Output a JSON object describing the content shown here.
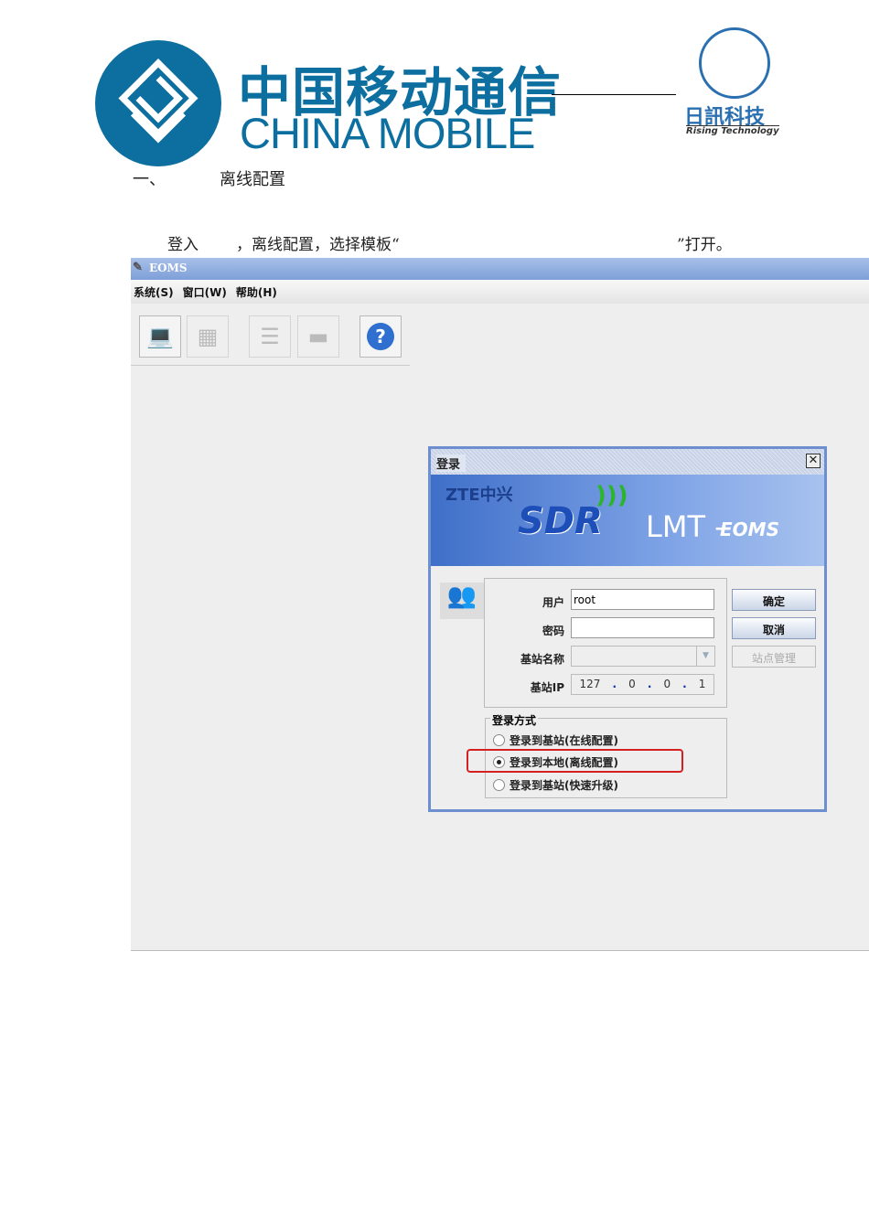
{
  "header": {
    "china_mobile_cn": "中国移动通信",
    "china_mobile_en": "CHINA MOBILE",
    "rising_cn": "日訊科技",
    "rising_en": "Rising Technology"
  },
  "doc": {
    "section_number": "一、",
    "section_title": "离线配置",
    "instruction_part1": "登入",
    "instruction_part2": "，离线配置，选择模板“",
    "instruction_part3": "”打开。"
  },
  "app": {
    "title": "EOMS",
    "menu": [
      {
        "label": "系统(S)"
      },
      {
        "label": "窗口(W)"
      },
      {
        "label": "帮助(H)"
      }
    ],
    "toolbar": [
      {
        "icon": "connect-icon",
        "enabled": true
      },
      {
        "icon": "offline-config-icon",
        "enabled": false
      },
      {
        "icon": "tree-icon",
        "enabled": false
      },
      {
        "icon": "panel-icon",
        "enabled": false
      },
      {
        "icon": "help-icon",
        "enabled": true
      }
    ],
    "login_dialog": {
      "title": "登录",
      "banner": {
        "brand": "ZTE中兴",
        "product": "SDR",
        "lmt": "LMT -",
        "eoms": "EOMS"
      },
      "user_label": "用户",
      "user_value": "root",
      "password_label": "密码",
      "password_value": "",
      "site_name_label": "基站名称",
      "site_name_value": "",
      "site_ip_label": "基站IP",
      "site_ip": [
        "127",
        "0",
        "0",
        "1"
      ],
      "ok_label": "确定",
      "cancel_label": "取消",
      "site_manage_label": "站点管理",
      "login_mode_label": "登录方式",
      "login_modes": [
        {
          "label": "登录到基站(在线配置)",
          "selected": false
        },
        {
          "label": "登录到本地(离线配置)",
          "selected": true
        },
        {
          "label": "登录到基站(快速升级)",
          "selected": false
        }
      ],
      "highlight_color": "#d42020"
    }
  }
}
